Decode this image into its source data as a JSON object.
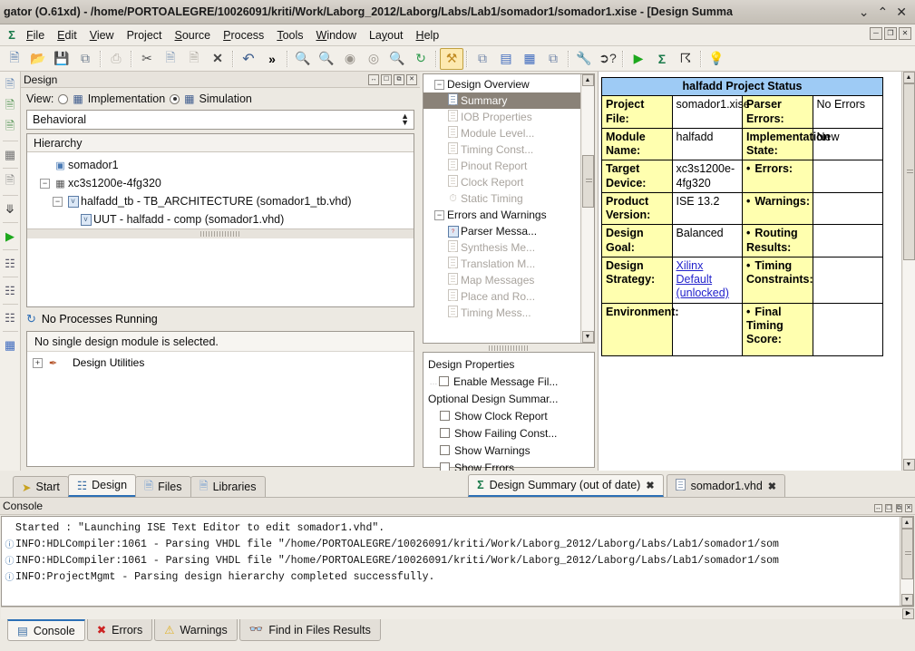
{
  "window": {
    "title": "gator (O.61xd) - /home/PORTOALEGRE/10026091/kriti/Work/Laborg_2012/Laborg/Labs/Lab1/somador1/somador1.xise - [Design Summa",
    "minimize": "⌄",
    "maximize": "⌃",
    "close": "✕",
    "mdi_minimize": "─",
    "mdi_restore": "❐",
    "mdi_close": "✕"
  },
  "menubar": {
    "app_icon": "sigma-icon",
    "items": [
      {
        "label": "File",
        "key": "F"
      },
      {
        "label": "Edit",
        "key": "E"
      },
      {
        "label": "View",
        "key": "V"
      },
      {
        "label": "Project",
        "key": "j"
      },
      {
        "label": "Source",
        "key": "S"
      },
      {
        "label": "Process",
        "key": "P"
      },
      {
        "label": "Tools",
        "key": "T"
      },
      {
        "label": "Window",
        "key": "W"
      },
      {
        "label": "Layout",
        "key": "L"
      },
      {
        "label": "Help",
        "key": "H"
      }
    ]
  },
  "toolbar": {
    "groups": [
      [
        "new-file-icon",
        "open-folder-icon",
        "save-icon",
        "save-all-icon"
      ],
      [
        "print-icon"
      ],
      [
        "cut-icon",
        "copy-icon",
        "paste-icon",
        "delete-icon"
      ],
      [
        "undo-icon",
        "more-chevrons-icon"
      ],
      [
        "zoom-in-icon",
        "zoom-out-icon",
        "zoom-fit-icon",
        "zoom-selection-icon",
        "zoom-area-icon",
        "refresh-icon"
      ],
      [
        "design-goals-icon"
      ],
      [
        "cascade-windows-icon",
        "tile-horizontal-icon",
        "tile-vertical-icon",
        "arrange-icon"
      ],
      [
        "settings-wrench-icon",
        "context-help-icon"
      ],
      [
        "run-icon",
        "sigma-icon",
        "explore-icon"
      ],
      [
        "tip-of-day-icon"
      ]
    ],
    "glyphs": {
      "new-file-icon": "❐",
      "open-folder-icon": "📂",
      "save-icon": "💾",
      "save-all-icon": "⧉",
      "print-icon": "⎙",
      "cut-icon": "✂",
      "copy-icon": "❐",
      "paste-icon": "▤",
      "delete-icon": "✕",
      "undo-icon": "↶",
      "more-chevrons-icon": "»",
      "zoom-in-icon": "🔍",
      "zoom-out-icon": "🔍",
      "zoom-fit-icon": "⬚",
      "zoom-selection-icon": "⬚",
      "zoom-area-icon": "🔍",
      "refresh-icon": "↻",
      "design-goals-icon": "⚒",
      "cascade-windows-icon": "⧉",
      "tile-horizontal-icon": "▤",
      "tile-vertical-icon": "▥",
      "arrange-icon": "❐",
      "settings-wrench-icon": "🔧",
      "context-help-icon": "?",
      "run-icon": "▶",
      "sigma-icon": "Σ",
      "explore-icon": "☈",
      "tip-of-day-icon": "💡"
    }
  },
  "vertical_toolbar": {
    "items": [
      "new-source-icon",
      "add-source-icon",
      "add-copy-source-icon",
      "separator",
      "manual-compile-icon",
      "separator",
      "view-text-icon",
      "separator",
      "expand-all-icon",
      "separator",
      "run-process-icon",
      "separator",
      "rerun-icon",
      "separator",
      "rerun-all-icon",
      "separator",
      "stop-icon",
      "separator",
      "panel-icon"
    ]
  },
  "design_panel": {
    "header": {
      "title": "Design",
      "buttons": [
        "↔",
        "❐",
        "⧉",
        "✕"
      ]
    },
    "view_label": "View:",
    "view_options": [
      {
        "label": "Implementation",
        "selected": false,
        "icon": "implementation-icon"
      },
      {
        "label": "Simulation",
        "selected": true,
        "icon": "simulation-icon"
      }
    ],
    "behavioral_select": "Behavioral",
    "hierarchy_header": "Hierarchy",
    "hierarchy": [
      {
        "label": "somador1",
        "indent": 1,
        "expander": "",
        "icon": "project-icon"
      },
      {
        "label": "xc3s1200e-4fg320",
        "indent": 0,
        "expander": "-",
        "icon": "chip-icon"
      },
      {
        "label": "halfadd_tb - TB_ARCHITECTURE (somador1_tb.vhd)",
        "indent": 1,
        "expander": "-",
        "icon": "vhdl-icon"
      },
      {
        "label": "UUT - halfadd - comp (somador1.vhd)",
        "indent": 2,
        "expander": "",
        "icon": "vhdl-icon"
      }
    ],
    "processes": {
      "status_icon": "refresh-icon",
      "status_text": "No Processes Running",
      "note": "No single design module is selected.",
      "items": [
        {
          "label": "Design Utilities",
          "expander": "+",
          "icon": "utilities-icon"
        }
      ]
    }
  },
  "summary_tree": {
    "nodes": [
      {
        "label": "Design Overview",
        "indent": 0,
        "expander": "-",
        "icon": "folder-icon",
        "state": "normal"
      },
      {
        "label": "Summary",
        "indent": 1,
        "expander": "",
        "icon": "doc-icon",
        "state": "selected"
      },
      {
        "label": "IOB Properties",
        "indent": 1,
        "expander": "",
        "icon": "doc-icon",
        "state": "dim"
      },
      {
        "label": "Module Level...",
        "indent": 1,
        "expander": "",
        "icon": "doc-icon",
        "state": "dim"
      },
      {
        "label": "Timing Const...",
        "indent": 1,
        "expander": "",
        "icon": "doc-icon",
        "state": "dim"
      },
      {
        "label": "Pinout Report",
        "indent": 1,
        "expander": "",
        "icon": "doc-icon",
        "state": "dim"
      },
      {
        "label": "Clock Report",
        "indent": 1,
        "expander": "",
        "icon": "doc-icon",
        "state": "dim"
      },
      {
        "label": "Static Timing",
        "indent": 1,
        "expander": "",
        "icon": "clock-icon",
        "state": "dim"
      },
      {
        "label": "Errors and Warnings",
        "indent": 0,
        "expander": "-",
        "icon": "folder-icon",
        "state": "normal"
      },
      {
        "label": "Parser Messa...",
        "indent": 1,
        "expander": "",
        "icon": "parser-icon",
        "state": "normal"
      },
      {
        "label": "Synthesis Me...",
        "indent": 1,
        "expander": "",
        "icon": "doc-icon",
        "state": "dim"
      },
      {
        "label": "Translation M...",
        "indent": 1,
        "expander": "",
        "icon": "doc-icon",
        "state": "dim"
      },
      {
        "label": "Map Messages",
        "indent": 1,
        "expander": "",
        "icon": "doc-icon",
        "state": "dim"
      },
      {
        "label": "Place and Ro...",
        "indent": 1,
        "expander": "",
        "icon": "doc-icon",
        "state": "dim"
      },
      {
        "label": "Timing Mess...",
        "indent": 1,
        "expander": "",
        "icon": "doc-icon",
        "state": "dim"
      }
    ],
    "scroll_up": "▲",
    "scroll_down": "▼"
  },
  "design_properties": {
    "title": "Design Properties",
    "items": [
      {
        "label": "Enable Message Fil...",
        "checked": false,
        "indented": true
      }
    ],
    "optional_title": "Optional Design Summar...",
    "optional_items": [
      {
        "label": "Show Clock Report",
        "checked": false
      },
      {
        "label": "Show Failing Const...",
        "checked": false
      },
      {
        "label": "Show Warnings",
        "checked": false
      },
      {
        "label": "Show Errors",
        "checked": false
      }
    ]
  },
  "project_status": {
    "title": "halfadd Project Status",
    "rows": [
      {
        "label": "Project File:",
        "value": "somador1.xise",
        "label2": "Parser Errors:",
        "value2": "No Errors",
        "bullet2": false,
        "link": false
      },
      {
        "label": "Module Name:",
        "value": "halfadd",
        "label2": "Implementation State:",
        "value2": "New",
        "bullet2": false,
        "link": false
      },
      {
        "label": "Target Device:",
        "value": "xc3s1200e-4fg320",
        "label2": "Errors:",
        "value2": "",
        "bullet2": true,
        "link": false
      },
      {
        "label": "Product Version:",
        "value": "ISE 13.2",
        "label2": "Warnings:",
        "value2": "",
        "bullet2": true,
        "link": false
      },
      {
        "label": "Design Goal:",
        "value": "Balanced",
        "label2": "Routing Results:",
        "value2": "",
        "bullet2": true,
        "link": false
      },
      {
        "label": "Design Strategy:",
        "value": "Xilinx Default (unlocked)",
        "label2": "Timing Constraints:",
        "value2": "",
        "bullet2": true,
        "link": true
      },
      {
        "label": "Environment:",
        "value": "",
        "label2": "Final Timing Score:",
        "value2": "",
        "bullet2": true,
        "link": false
      }
    ],
    "colors": {
      "title_bg": "#9ecbf5",
      "label_bg": "#ffffaf",
      "value_bg": "#ffffff",
      "link": "#2222cc"
    }
  },
  "left_tabs": [
    {
      "label": "Start",
      "icon": "start-icon",
      "active": false
    },
    {
      "label": "Design",
      "icon": "design-icon",
      "active": true
    },
    {
      "label": "Files",
      "icon": "files-icon",
      "active": false
    },
    {
      "label": "Libraries",
      "icon": "libraries-icon",
      "active": false
    }
  ],
  "editor_tabs": [
    {
      "label": "Design Summary (out of date)",
      "icon": "sigma-icon",
      "active": true,
      "close": "✖"
    },
    {
      "label": "somador1.vhd",
      "icon": "vhdl-icon",
      "active": false,
      "close": "✖"
    }
  ],
  "console": {
    "header": {
      "title": "Console",
      "buttons": [
        "↔",
        "❐",
        "⧉",
        "✕"
      ]
    },
    "lines": [
      {
        "icon": "",
        "text": "Started : \"Launching ISE Text Editor to edit somador1.vhd\"."
      },
      {
        "icon": "info-icon",
        "text": "INFO:HDLCompiler:1061 - Parsing VHDL file \"/home/PORTOALEGRE/10026091/kriti/Work/Laborg_2012/Laborg/Labs/Lab1/somador1/som"
      },
      {
        "icon": "info-icon",
        "text": "INFO:HDLCompiler:1061 - Parsing VHDL file \"/home/PORTOALEGRE/10026091/kriti/Work/Laborg_2012/Laborg/Labs/Lab1/somador1/som"
      },
      {
        "icon": "info-icon",
        "text": "INFO:ProjectMgmt - Parsing design hierarchy completed successfully."
      }
    ],
    "scroll_up": "▲",
    "scroll_down": "▼",
    "scroll_right": "▶"
  },
  "bottom_tabs": [
    {
      "label": "Console",
      "icon": "console-icon",
      "active": true
    },
    {
      "label": "Errors",
      "icon": "error-icon",
      "active": false
    },
    {
      "label": "Warnings",
      "icon": "warning-icon",
      "active": false
    },
    {
      "label": "Find in Files Results",
      "icon": "binoculars-icon",
      "active": false
    }
  ]
}
